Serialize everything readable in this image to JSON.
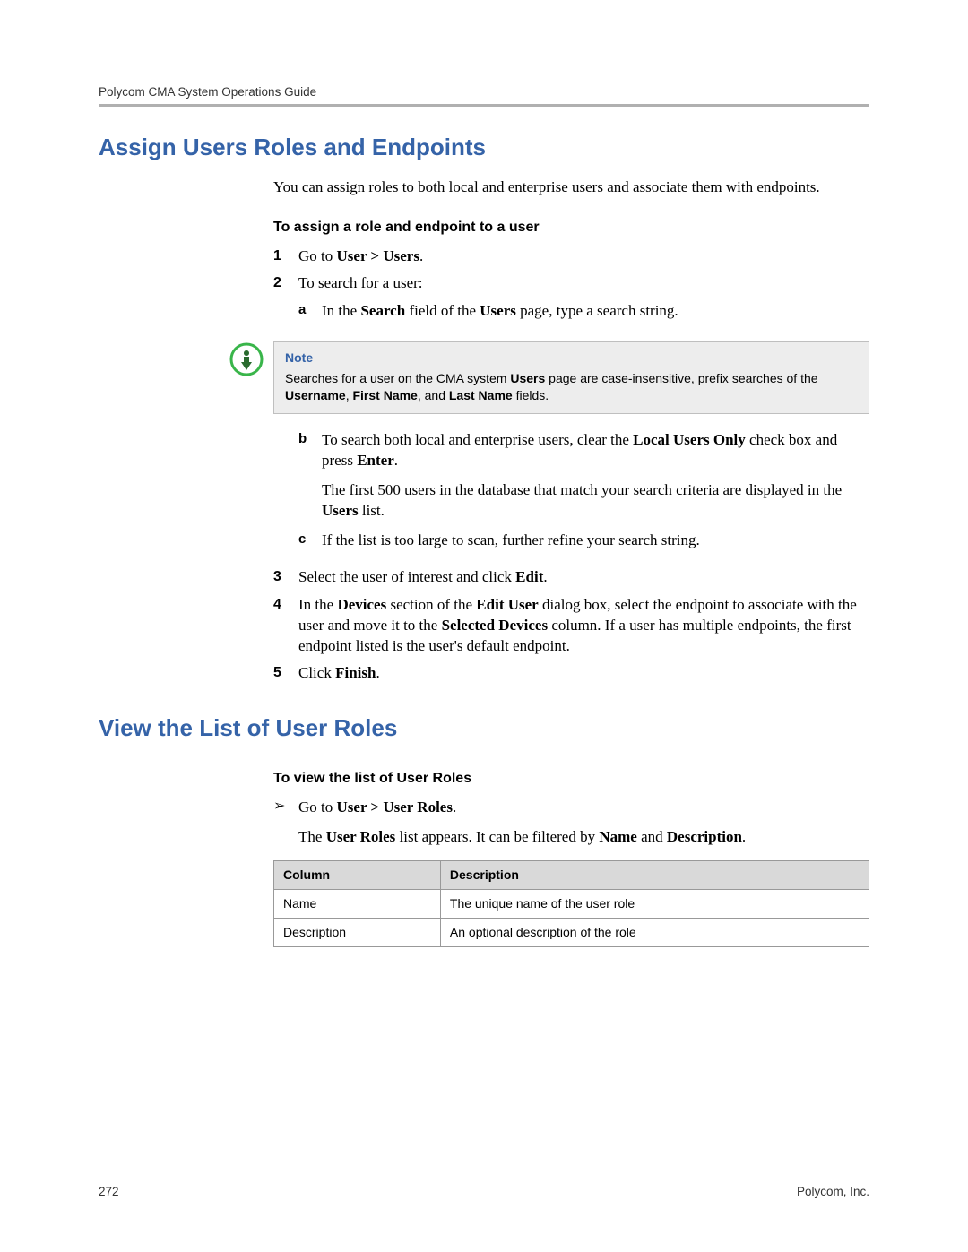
{
  "header": {
    "title": "Polycom CMA System Operations Guide"
  },
  "section1": {
    "heading": "Assign Users Roles and Endpoints",
    "intro": "You can assign roles to both local and enterprise users and associate them with endpoints.",
    "subhead": "To assign a role and endpoint to a user",
    "step1_pre": "Go to ",
    "step1_bold": "User > Users",
    "step1_post": ".",
    "step2": "To search for a user:",
    "step2a_pre": "In the ",
    "step2a_b1": "Search",
    "step2a_mid": " field of the ",
    "step2a_b2": "Users",
    "step2a_post": " page, type a search string.",
    "note_title": "Note",
    "note_pre": "Searches for a user on the CMA system ",
    "note_b1": "Users",
    "note_mid1": " page are case-insensitive, prefix searches of the ",
    "note_b2": "Username",
    "note_c1": ", ",
    "note_b3": "First Name",
    "note_c2": ", and ",
    "note_b4": "Last Name",
    "note_post": " fields.",
    "step2b_pre": "To search both local and enterprise users, clear the ",
    "step2b_b1": "Local Users Only",
    "step2b_mid": " check box and press ",
    "step2b_b2": "Enter",
    "step2b_post": ".",
    "step2b_p2_pre": "The first 500 users in the database that match your search criteria are displayed in the ",
    "step2b_p2_b1": "Users",
    "step2b_p2_post": " list.",
    "step2c": "If the list is too large to scan, further refine your search string.",
    "step3_pre": "Select the user of interest and click ",
    "step3_b1": "Edit",
    "step3_post": ".",
    "step4_pre": "In the ",
    "step4_b1": "Devices",
    "step4_mid1": " section of the ",
    "step4_b2": "Edit User",
    "step4_mid2": " dialog box, select the endpoint to associate with the user and move it to the ",
    "step4_b3": "Selected Devices",
    "step4_post": " column. If a user has multiple endpoints, the first endpoint listed is the user's default endpoint.",
    "step5_pre": "Click ",
    "step5_b1": "Finish",
    "step5_post": "."
  },
  "section2": {
    "heading": "View the List of User Roles",
    "subhead": "To view the list of User Roles",
    "arrow_pre": "Go to ",
    "arrow_b1": "User > User Roles",
    "arrow_post": ".",
    "result_pre": "The ",
    "result_b1": "User Roles",
    "result_mid": " list appears. It can be filtered by ",
    "result_b2": "Name",
    "result_c1": " and ",
    "result_b3": "Description",
    "result_post": ".",
    "table": {
      "th1": "Column",
      "th2": "Description",
      "r1c1": "Name",
      "r1c2": "The unique name of the user role",
      "r2c1": "Description",
      "r2c2": "An optional description of the role"
    }
  },
  "footer": {
    "page": "272",
    "company": "Polycom, Inc."
  }
}
